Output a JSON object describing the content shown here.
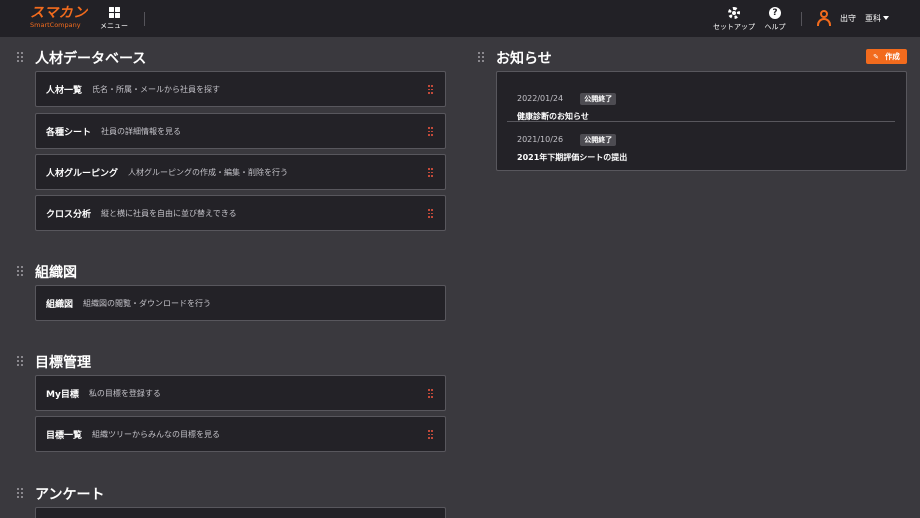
{
  "header": {
    "logo_main": "スマカン",
    "logo_sub": "SmartCompany",
    "menu_label": "メニュー",
    "setup_label": "セットアップ",
    "help_label": "ヘルプ",
    "help_glyph": "?",
    "user_name": "出守",
    "user_dept": "亜科"
  },
  "sections": [
    {
      "title": "人材データベース",
      "cards": [
        {
          "title": "人材一覧",
          "desc": "氏名・所属・メールから社員を探す"
        },
        {
          "title": "各種シート",
          "desc": "社員の詳細情報を見る"
        },
        {
          "title": "人材グルーピング",
          "desc": "人材グルーピングの作成・編集・削除を行う"
        },
        {
          "title": "クロス分析",
          "desc": "縦と横に社員を自由に並び替えできる"
        }
      ]
    },
    {
      "title": "組織図",
      "cards": [
        {
          "title": "組織図",
          "desc": "組織図の閲覧・ダウンロードを行う"
        }
      ]
    },
    {
      "title": "目標管理",
      "cards": [
        {
          "title": "My目標",
          "desc": "私の目標を登録する"
        },
        {
          "title": "目標一覧",
          "desc": "組織ツリーからみんなの目標を見る"
        }
      ]
    },
    {
      "title": "アンケート",
      "cards": []
    }
  ],
  "news": {
    "title": "お知らせ",
    "create_label": "作成",
    "items": [
      {
        "date": "2022/01/24",
        "badge": "公開終了",
        "text": "健康診断のお知らせ"
      },
      {
        "date": "2021/10/26",
        "badge": "公開終了",
        "text": "2021年下期評価シートの提出"
      }
    ]
  },
  "colors": {
    "accent": "#f26b1d",
    "background": "#3a393e",
    "header_bg": "#222126",
    "card_bg": "#232227"
  }
}
